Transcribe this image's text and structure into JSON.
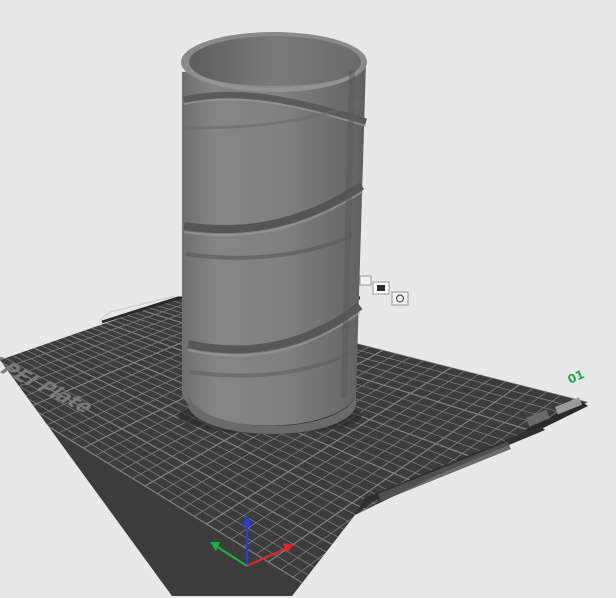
{
  "viewport": {
    "bed_label": "Smooth Textured PEI Plate",
    "bed_number": "01",
    "background_color": "#e8e8e8",
    "bed_color": "#3c3c3c",
    "grid_color": "#8f8f8f",
    "model_color": "#7d7d7d"
  },
  "axes": {
    "x_color": "#e0252a",
    "y_color": "#17b23a",
    "z_color": "#2a3bd6"
  },
  "toolbar": {
    "icons": [
      "arrange-icon",
      "orient-icon",
      "settings-icon"
    ]
  }
}
